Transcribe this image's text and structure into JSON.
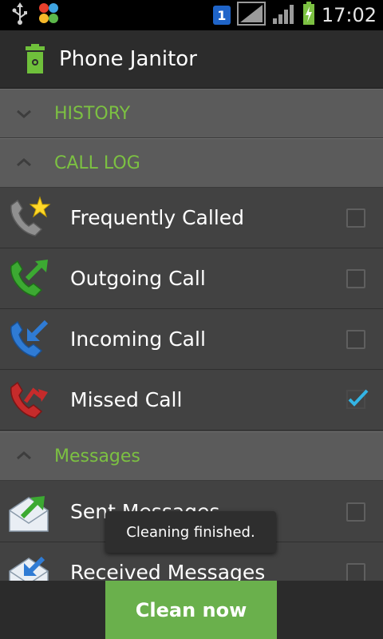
{
  "status_bar": {
    "time": "17:02",
    "sim_label": "1"
  },
  "app": {
    "title": "Phone Janitor"
  },
  "sections": {
    "history": {
      "label": "HISTORY",
      "expanded": false
    },
    "call_log": {
      "label": "CALL LOG",
      "expanded": true
    },
    "messages": {
      "label": "Messages",
      "expanded": true
    }
  },
  "items": [
    {
      "label": "Frequently Called",
      "checked": false
    },
    {
      "label": "Outgoing Call",
      "checked": false
    },
    {
      "label": "Incoming Call",
      "checked": false
    },
    {
      "label": "Missed Call",
      "checked": true
    },
    {
      "label": "Sent Messages",
      "checked": false
    },
    {
      "label": "Received Messages",
      "checked": false
    }
  ],
  "toast": {
    "text": "Cleaning finished."
  },
  "footer": {
    "clean_label": "Clean now"
  },
  "colors": {
    "accent_green": "#7cc142",
    "button_green": "#6ab04c",
    "check_blue": "#33b5e5"
  }
}
